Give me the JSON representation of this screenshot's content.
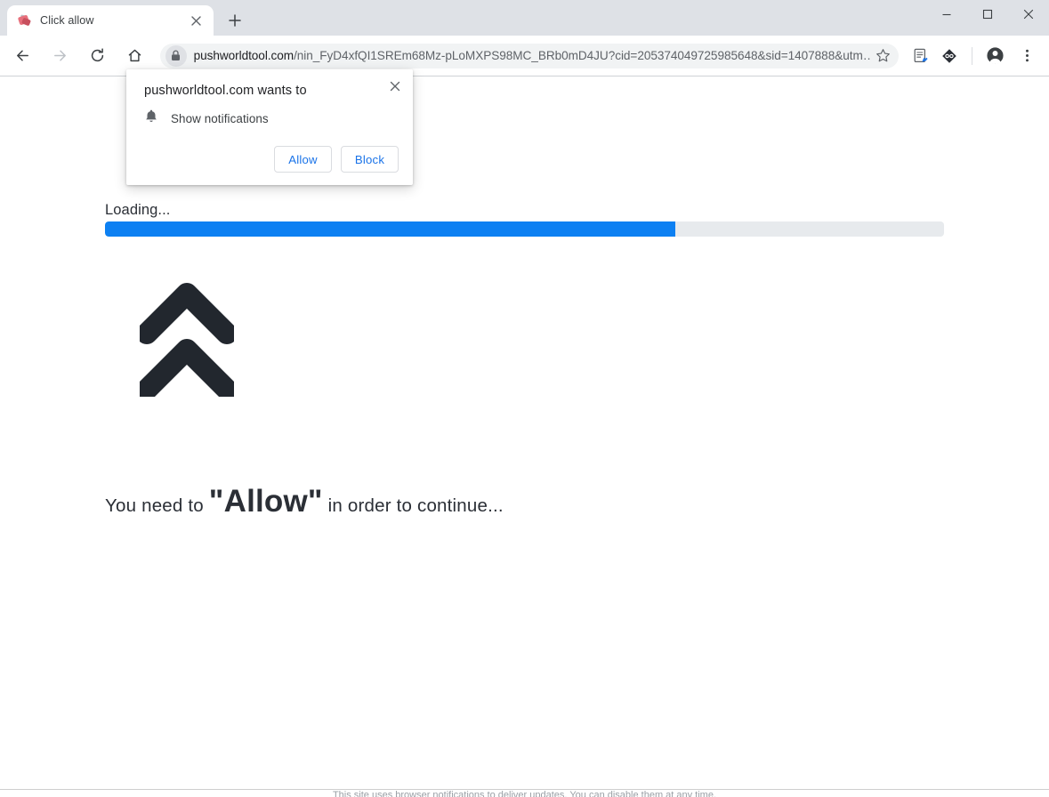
{
  "window": {
    "minimize_label": "Minimize",
    "maximize_label": "Maximize",
    "close_label": "Close"
  },
  "tabstrip": {
    "tabs": [
      {
        "title": "Click allow",
        "favicon": "site-favicon",
        "close_label": "✕",
        "active": true
      }
    ],
    "new_tab_label": "+"
  },
  "toolbar": {
    "back_label": "Back",
    "forward_label": "Forward",
    "reload_label": "Reload",
    "home_label": "Home",
    "security_icon": "lock-icon",
    "url_host": "pushworldtool.com",
    "url_path": "/nin_FyD4xfQI1SREm68Mz-pLoMXPS98MC_BRb0mD4JU?cid=205374049725985648&sid=1407888&utm…",
    "url_full": "pushworldtool.com/nin_FyD4xfQI1SREm68Mz-pLoMXPS98MC_BRb0mD4JU?cid=205374049725985648&sid=1407888&utm…",
    "bookmark_label": "Bookmark this tab",
    "extensions": [
      {
        "name": "note-editor-extension-icon"
      },
      {
        "name": "diamond-extension-icon"
      }
    ],
    "profile_label": "Profile",
    "menu_label": "Customize and control Google Chrome"
  },
  "permission_bubble": {
    "title": "pushworldtool.com wants to",
    "close_label": "✕",
    "request_icon": "bell-icon",
    "request_label": "Show notifications",
    "allow_label": "Allow",
    "block_label": "Block",
    "accent_color": "#1a73e8"
  },
  "page": {
    "loading_label": "Loading...",
    "progress_percent": 68,
    "progress_fill_color": "#0d80f2",
    "progress_track_color": "#e7eaed",
    "chevrons_icon": "double-chevron-up-icon",
    "chevrons_color": "#22272e",
    "headline_prefix": "You need to ",
    "headline_emphasis": "\"Allow\"",
    "headline_suffix": " in order to continue...",
    "footer_text": "This site uses browser notifications to deliver updates. You can disable them at any time."
  }
}
